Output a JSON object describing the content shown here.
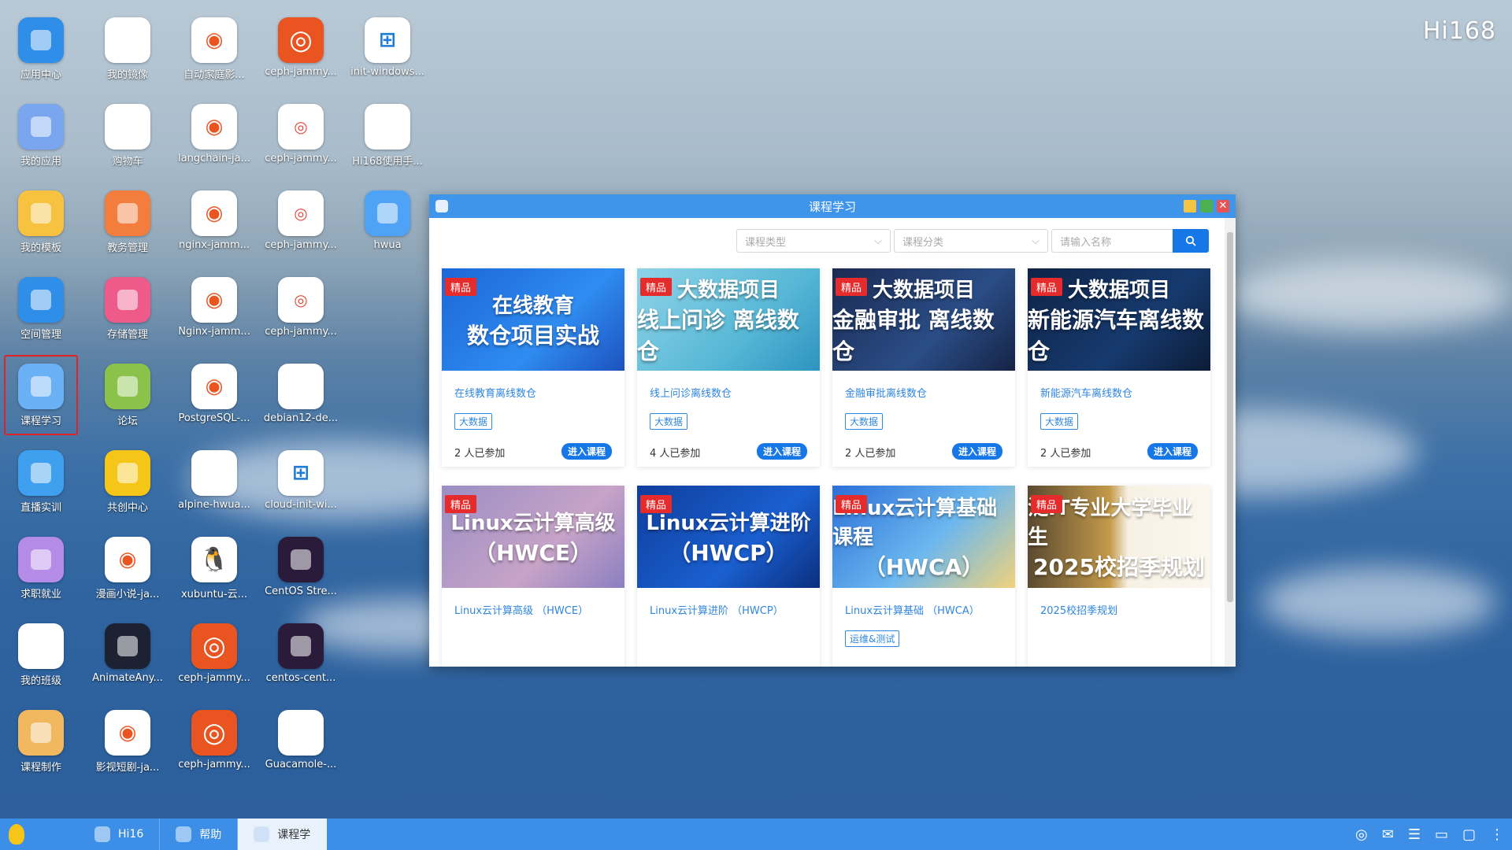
{
  "brand": "Hi168",
  "desktop": {
    "icons": [
      {
        "label": "应用中心",
        "icon": "app-center-icon",
        "color": "#2f8fe8"
      },
      {
        "label": "我的镜像",
        "icon": "mirror-icon",
        "color": "#ffffff"
      },
      {
        "label": "自动家庭影...",
        "icon": "ubuntu-icon",
        "color": "#ffffff"
      },
      {
        "label": "ceph-jammy...",
        "icon": "ubuntu-logo-icon",
        "color": "#e95420"
      },
      {
        "label": "init-windows...",
        "icon": "windows-icon",
        "color": "#ffffff"
      },
      {
        "label": "我的应用",
        "icon": "app-icon",
        "color": "#7aa6f0"
      },
      {
        "label": "购物车",
        "icon": "cart-icon",
        "color": "#ffffff"
      },
      {
        "label": "langchain-ja...",
        "icon": "ubuntu-icon",
        "color": "#ffffff"
      },
      {
        "label": "ceph-jammy...",
        "icon": "ceph-icon",
        "color": "#ffffff"
      },
      {
        "label": "Hi168使用手...",
        "icon": "manual-icon",
        "color": "#ffffff"
      },
      {
        "label": "我的模板",
        "icon": "folder-icon",
        "color": "#f7c23f"
      },
      {
        "label": "教务管理",
        "icon": "book-icon",
        "color": "#f27d3c"
      },
      {
        "label": "nginx-jamm...",
        "icon": "ubuntu-icon",
        "color": "#ffffff"
      },
      {
        "label": "ceph-jammy...",
        "icon": "ceph-icon",
        "color": "#ffffff"
      },
      {
        "label": "hwua",
        "icon": "paint-icon",
        "color": "#4fa3f7"
      },
      {
        "label": "空间管理",
        "icon": "space-icon",
        "color": "#2f8fe8"
      },
      {
        "label": "存储管理",
        "icon": "storage-icon",
        "color": "#ee5a8a"
      },
      {
        "label": "Nginx-jamm...",
        "icon": "ubuntu-icon",
        "color": "#ffffff"
      },
      {
        "label": "ceph-jammy...",
        "icon": "ceph-icon",
        "color": "#ffffff"
      },
      {
        "label": "",
        "icon": "",
        "color": ""
      },
      {
        "label": "课程学习",
        "icon": "course-icon",
        "color": "#6ab0f5"
      },
      {
        "label": "论坛",
        "icon": "forum-icon",
        "color": "#8bc34a"
      },
      {
        "label": "PostgreSQL-...",
        "icon": "ubuntu-icon",
        "color": "#ffffff"
      },
      {
        "label": "debian12-de...",
        "icon": "debian-icon",
        "color": "#ffffff"
      },
      {
        "label": "",
        "icon": "",
        "color": ""
      },
      {
        "label": "直播实训",
        "icon": "play-icon",
        "color": "#3fa0f0"
      },
      {
        "label": "共创中心",
        "icon": "cocreate-icon",
        "color": "#f5c518"
      },
      {
        "label": "alpine-hwua...",
        "icon": "alpine-icon",
        "color": "#ffffff"
      },
      {
        "label": "cloud-init-wi...",
        "icon": "windows-icon",
        "color": "#ffffff"
      },
      {
        "label": "",
        "icon": "",
        "color": ""
      },
      {
        "label": "求职就业",
        "icon": "key-icon",
        "color": "#b58be8"
      },
      {
        "label": "漫画小说-ja...",
        "icon": "ubuntu-icon",
        "color": "#ffffff"
      },
      {
        "label": "xubuntu-云...",
        "icon": "linux-penguin-icon",
        "color": "#ffffff"
      },
      {
        "label": "CentOS Stre...",
        "icon": "centos-icon",
        "color": "#2b1b3a"
      },
      {
        "label": "",
        "icon": "",
        "color": ""
      },
      {
        "label": "我的班级",
        "icon": "class-icon",
        "color": "#ffffff"
      },
      {
        "label": "AnimateAny...",
        "icon": "animate-icon",
        "color": "#1d2233"
      },
      {
        "label": "ceph-jammy...",
        "icon": "ubuntu-logo-icon",
        "color": "#e95420"
      },
      {
        "label": "centos-cent...",
        "icon": "centos-icon",
        "color": "#2b1b3a"
      },
      {
        "label": "",
        "icon": "",
        "color": ""
      },
      {
        "label": "课程制作",
        "icon": "course-make-icon",
        "color": "#f2b860"
      },
      {
        "label": "影视短剧-ja...",
        "icon": "ubuntu-icon",
        "color": "#ffffff"
      },
      {
        "label": "ceph-jammy...",
        "icon": "ubuntu-logo-icon",
        "color": "#e95420"
      },
      {
        "label": "Guacamole-...",
        "icon": "guacamole-icon",
        "color": "#ffffff"
      }
    ]
  },
  "window": {
    "title": "课程学习",
    "filters": {
      "type_placeholder": "课程类型",
      "category_placeholder": "课程分类",
      "search_placeholder": "请输入名称"
    },
    "courses": [
      {
        "tag": "精品",
        "name": "在线教育离线数仓",
        "thumb_line1": "在线教育",
        "thumb_line2": "数仓项目实战",
        "badge": "大数据",
        "count": "2 人已参加",
        "enter": "进入课程",
        "bg": "linear-gradient(135deg,#1c66d8,#2f8cf0 60%,#1d52c0)"
      },
      {
        "tag": "精品",
        "name": "线上问诊离线数仓",
        "thumb_line1": "大数据项目",
        "thumb_line2": "线上问诊 离线数仓",
        "badge": "大数据",
        "count": "4 人已参加",
        "enter": "进入课程",
        "bg": "linear-gradient(135deg,#8fd3e8,#57b8d6 60%,#2f93c0)"
      },
      {
        "tag": "精品",
        "name": "金融审批离线数仓",
        "thumb_line1": "大数据项目",
        "thumb_line2": "金融审批 离线数仓",
        "badge": "大数据",
        "count": "2 人已参加",
        "enter": "进入课程",
        "bg": "linear-gradient(135deg,#1b2a52,#2a4d86 60%,#152345)"
      },
      {
        "tag": "精品",
        "name": "新能源汽车离线数仓",
        "thumb_line1": "大数据项目",
        "thumb_line2": "新能源汽车离线数仓",
        "badge": "大数据",
        "count": "2 人已参加",
        "enter": "进入课程",
        "bg": "linear-gradient(135deg,#0e2346,#163a6e 60%,#0b1b36)"
      },
      {
        "tag": "精品",
        "name": "Linux云计算高级 （HWCE）",
        "thumb_line1": "Linux云计算高级",
        "thumb_line2": "（HWCE）",
        "badge": "",
        "count": "",
        "enter": "",
        "bg": "linear-gradient(135deg,#9a8ec4,#c7a3c7 60%,#8b7fc0)"
      },
      {
        "tag": "精品",
        "name": "Linux云计算进阶 （HWCP）",
        "thumb_line1": "Linux云计算进阶",
        "thumb_line2": "（HWCP）",
        "badge": "",
        "count": "",
        "enter": "",
        "bg": "linear-gradient(135deg,#0f3e9c,#1a5fd0 60%,#0b2f7e)"
      },
      {
        "tag": "精品",
        "name": "Linux云计算基础 （HWCA）",
        "thumb_line1": "Linux云计算基础课程",
        "thumb_line2": "（HWCA）",
        "badge": "运维&测试",
        "count": "",
        "enter": "",
        "bg": "linear-gradient(135deg,#2b6fd8,#6bb7ef 55%,#f2d27a)"
      },
      {
        "tag": "精品",
        "name": "2025校招季规划",
        "thumb_line1": "泛IT专业大学毕业生",
        "thumb_line2": "2025校招季规划",
        "badge": "",
        "count": "",
        "enter": "",
        "bg": "linear-gradient(90deg,#5a4a30,#c49a4a 45%,#f7f1e4 55%,#fbf7ee)"
      }
    ]
  },
  "taskbar": {
    "items": [
      {
        "label": "Hi16",
        "icon": "hi16-icon",
        "active": false
      },
      {
        "label": "帮助",
        "icon": "headset-icon",
        "active": false
      },
      {
        "label": "课程学",
        "icon": "course-icon",
        "active": true
      }
    ]
  }
}
